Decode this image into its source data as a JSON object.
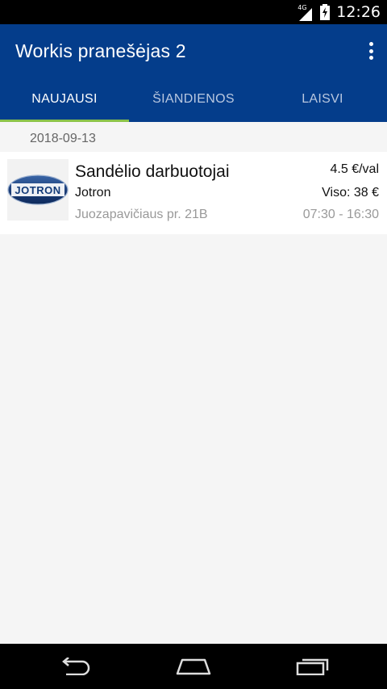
{
  "status_bar": {
    "network": "4G",
    "time": "12:26",
    "icons": [
      "signal-icon",
      "battery-charging-icon"
    ]
  },
  "app_bar": {
    "title": "Workis pranešėjas 2",
    "menu_icon": "overflow-menu-icon"
  },
  "tabs": [
    {
      "label": "NAUJAUSI",
      "active": true
    },
    {
      "label": "ŠIANDIENOS",
      "active": false
    },
    {
      "label": "LAISVI",
      "active": false
    }
  ],
  "accent_color": "#8bc34a",
  "brand_color": "#043d8b",
  "jobs": [
    {
      "date": "2018-09-13",
      "title": "Sandėlio darbuotojai",
      "company": "Jotron",
      "address": "Juozapavičiaus pr. 21B",
      "rate": "4.5 €/val",
      "total": "Viso: 38 €",
      "hours": "07:30 - 16:30",
      "logo_text": "JOTRON"
    }
  ],
  "nav_bar": {
    "icons": [
      "back-icon",
      "home-icon",
      "recent-apps-icon"
    ]
  }
}
